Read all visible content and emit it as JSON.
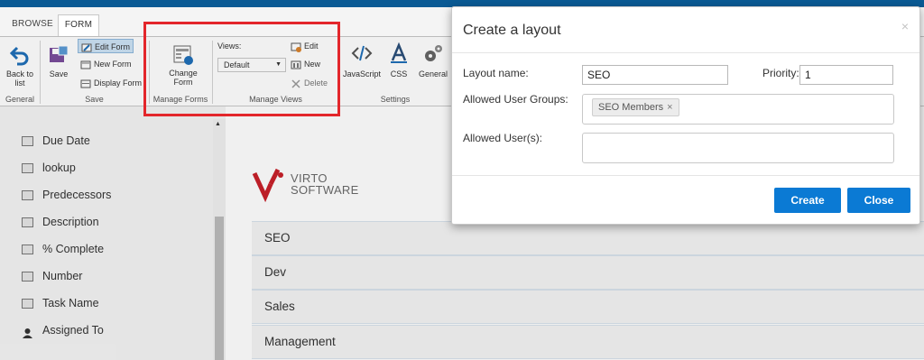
{
  "tabs": {
    "browse": "BROWSE",
    "form": "FORM"
  },
  "ribbon": {
    "back_to_list_line1": "Back to",
    "back_to_list_line2": "list",
    "save": "Save",
    "edit_form": "Edit Form",
    "new_form": "New Form",
    "display_form": "Display Form",
    "change_form_line1": "Change",
    "change_form_line2": "Form",
    "views_label": "Views:",
    "views_selected": "Default",
    "view_edit": "Edit",
    "view_new": "New",
    "view_delete": "Delete",
    "javascript": "JavaScript",
    "css": "CSS",
    "general": "General",
    "groups": {
      "general": "General",
      "save": "Save",
      "manage_forms": "Manage Forms",
      "manage_views": "Manage Views",
      "settings": "Settings"
    }
  },
  "fields": [
    "Due Date",
    "lookup",
    "Predecessors",
    "Description",
    "% Complete",
    "Number",
    "Task Name",
    "Assigned To"
  ],
  "logo": {
    "line1": "VIRTO",
    "line2": "SOFTWARE"
  },
  "layouts": [
    "SEO",
    "Dev",
    "Sales",
    "Management"
  ],
  "modal": {
    "title": "Create a layout",
    "close_glyph": "×",
    "layout_name_label": "Layout name:",
    "layout_name_value": "SEO",
    "priority_label": "Priority:",
    "priority_value": "1",
    "groups_label": "Allowed User Groups:",
    "group_token": "SEO  Members",
    "token_remove": "×",
    "users_label": "Allowed User(s):",
    "create_button": "Create",
    "close_button": "Close"
  },
  "colors": {
    "accent": "#0b7ad4",
    "highlight": "#e3262b",
    "topbar": "#0a5a94"
  }
}
